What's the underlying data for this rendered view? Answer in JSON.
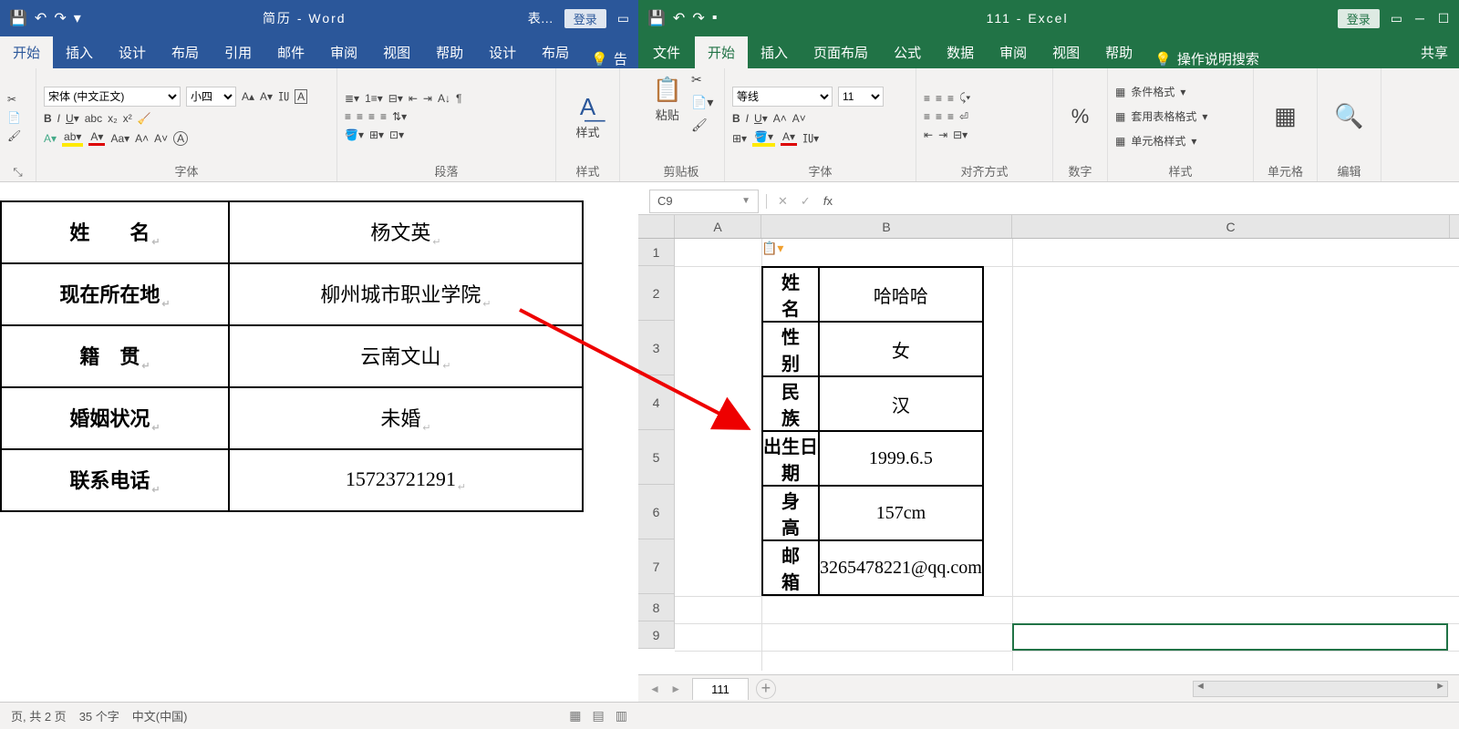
{
  "word": {
    "title": "简历  -  Word",
    "title_extra": "表…",
    "login": "登录",
    "qat": {
      "save": "💾",
      "undo": "↶",
      "redo": "↷",
      "more": "▾"
    },
    "tabs": [
      "开始",
      "插入",
      "设计",
      "布局",
      "引用",
      "邮件",
      "审阅",
      "视图",
      "帮助",
      "设计",
      "布局"
    ],
    "tell": "告",
    "font_name": "宋体 (中文正文)",
    "font_size": "小四",
    "group_font": "字体",
    "group_para": "段落",
    "group_styles": "样式",
    "styles_label": "样式",
    "status_page": "页, 共 2 页",
    "status_words": "35 个字",
    "status_lang": "中文(中国)",
    "table": [
      {
        "label": "姓　　名",
        "value": "杨文英"
      },
      {
        "label": "现在所在地",
        "value": "柳州城市职业学院"
      },
      {
        "label": "籍　贯",
        "value": "云南文山"
      },
      {
        "label": "婚姻状况",
        "value": "未婚"
      },
      {
        "label": "联系电话",
        "value": "15723721291"
      }
    ]
  },
  "excel": {
    "title": "111  -  Excel",
    "login": "登录",
    "qat": {
      "save": "💾",
      "undo": "↶",
      "redo": "↷",
      "more": "▪"
    },
    "tabs_file": "文件",
    "tabs": [
      "开始",
      "插入",
      "页面布局",
      "公式",
      "数据",
      "审阅",
      "视图",
      "帮助"
    ],
    "tell": "操作说明搜索",
    "share": "共享",
    "font_name": "等线",
    "font_size": "11",
    "group_clip": "剪贴板",
    "group_font": "字体",
    "group_align": "对齐方式",
    "group_num": "数字",
    "group_styles": "样式",
    "group_cells": "单元格",
    "group_edit": "编辑",
    "btn_paste": "粘贴",
    "cond_fmt": "条件格式",
    "tbl_fmt": "套用表格格式",
    "cell_fmt": "单元格样式",
    "namebox": "C9",
    "cols": [
      "A",
      "B",
      "C"
    ],
    "rows": [
      "1",
      "2",
      "3",
      "4",
      "5",
      "6",
      "7",
      "8",
      "9"
    ],
    "sheet_name": "111",
    "table": [
      {
        "label": "姓　　名",
        "value": "哈哈哈"
      },
      {
        "label": "性　　别",
        "value": "女"
      },
      {
        "label": "民　　族",
        "value": "汉"
      },
      {
        "label": "出生日期",
        "value": "1999.6.5"
      },
      {
        "label": "身　　高",
        "value": "157cm"
      },
      {
        "label": "邮　　箱",
        "value": "3265478221@qq.com"
      }
    ]
  }
}
